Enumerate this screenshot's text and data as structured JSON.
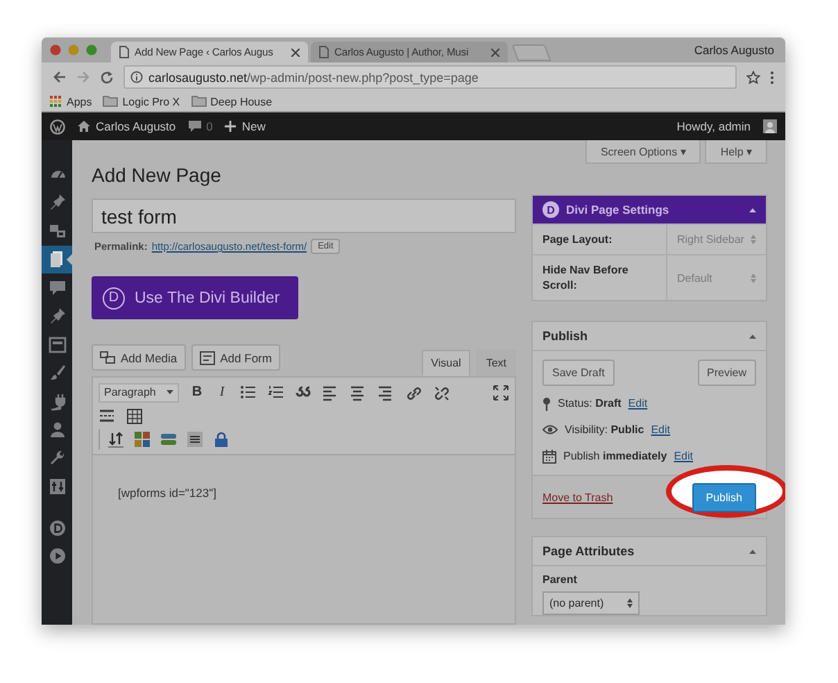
{
  "browser": {
    "tabs": [
      {
        "title": "Add New Page ‹ Carlos Augus",
        "selected": true
      },
      {
        "title": "Carlos Augusto | Author, Musi",
        "selected": false
      }
    ],
    "profile": "Carlos Augusto",
    "url": "**carlosaugusto.net**/wp-admin/post-new.php?post_type=page",
    "bookmarks": [
      {
        "kind": "apps",
        "label": "Apps"
      },
      {
        "kind": "folder",
        "label": "Logic Pro X"
      },
      {
        "kind": "folder",
        "label": "Deep House"
      }
    ]
  },
  "admin_bar": {
    "site": "Carlos Augusto",
    "comments": "0",
    "new": "New",
    "greeting": "Howdy, admin"
  },
  "sidebar": {
    "items": [
      {
        "kind": "dashboard",
        "selected": false
      },
      {
        "kind": "pin",
        "selected": false
      },
      {
        "kind": "media",
        "selected": false
      },
      {
        "kind": "pages",
        "selected": true
      },
      {
        "kind": "comments",
        "selected": false
      },
      {
        "kind": "pin",
        "selected": false
      },
      {
        "kind": "panel",
        "selected": false
      },
      {
        "kind": "brush",
        "selected": false
      },
      {
        "kind": "plug",
        "selected": false
      },
      {
        "kind": "user",
        "selected": false
      },
      {
        "kind": "wrench",
        "selected": false
      },
      {
        "kind": "sliders",
        "selected": false
      },
      {
        "kind": "divi",
        "selected": false
      },
      {
        "kind": "play",
        "selected": false
      }
    ]
  },
  "header_buttons": [
    "Screen Options ▾",
    "Help ▾"
  ],
  "page_title": "Add New Page",
  "title_field": {
    "value": "test form"
  },
  "permalink": {
    "label": "Permalink:",
    "url": "http://carlosaugusto.net/test-form/",
    "edit": "Edit"
  },
  "divi_button": {
    "logo": "D",
    "label": "Use The Divi Builder"
  },
  "editor": {
    "media_buttons": [
      {
        "kind": "media",
        "label": "Add Media"
      },
      {
        "kind": "form",
        "label": "Add Form"
      }
    ],
    "tabs": [
      {
        "label": "Visual",
        "selected": true
      },
      {
        "label": "Text",
        "selected": false
      }
    ],
    "toolbar_rows": [
      [
        {
          "kind": "format",
          "label": "Paragraph"
        },
        {
          "kind": "bold",
          "label": "B"
        },
        {
          "kind": "italic",
          "label": "I"
        },
        {
          "kind": "bullets"
        },
        {
          "kind": "numbers"
        },
        {
          "kind": "quote"
        },
        {
          "kind": "align-left"
        },
        {
          "kind": "align-center"
        },
        {
          "kind": "align-right"
        },
        {
          "kind": "link"
        },
        {
          "kind": "unlink"
        },
        {
          "kind": "fullscreen"
        }
      ],
      [
        {
          "kind": "more"
        },
        {
          "kind": "table"
        }
      ],
      [
        {
          "kind": "sort"
        },
        {
          "kind": "grid"
        },
        {
          "kind": "layers"
        },
        {
          "kind": "lines"
        },
        {
          "kind": "lock"
        }
      ]
    ],
    "content": "[wpforms id=\"123\"]"
  },
  "divi_settings": {
    "logo": "D",
    "title": "Divi Page Settings",
    "rows": [
      {
        "label": "Page Layout:",
        "value": "Right Sidebar"
      },
      {
        "label": "Hide Nav Before Scroll:",
        "value": "Default"
      }
    ]
  },
  "publish": {
    "title": "Publish",
    "save_draft": "Save Draft",
    "preview": "Preview",
    "lines": [
      {
        "kind": "status",
        "text": "Status: **Draft**",
        "link": "Edit"
      },
      {
        "kind": "visibility",
        "text": "Visibility: **Public**",
        "link": "Edit"
      },
      {
        "kind": "schedule",
        "text": "Publish **immediately**",
        "link": "Edit"
      }
    ],
    "trash": "Move to Trash",
    "button": {
      "label": "Publish",
      "highlighted": true
    }
  },
  "page_attributes": {
    "title": "Page Attributes",
    "parent_label": "Parent",
    "parent_value": "(no parent)"
  }
}
